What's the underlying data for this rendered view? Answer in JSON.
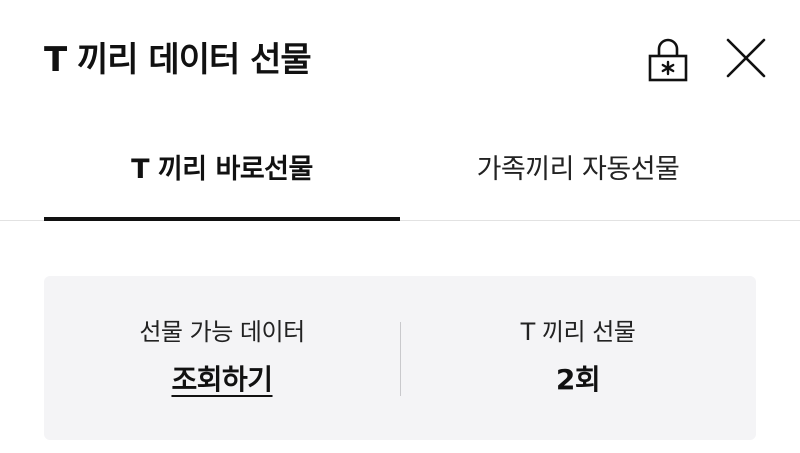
{
  "header": {
    "title": "T 끼리 데이터 선물",
    "lock_icon": "lock-asterisk-icon",
    "close_icon": "close-icon"
  },
  "tabs": [
    {
      "label": "T 끼리 바로선물",
      "active": true
    },
    {
      "label": "가족끼리 자동선물",
      "active": false
    }
  ],
  "info": {
    "data_label": "선물 가능 데이터",
    "data_link": "조회하기",
    "gift_label": "T 끼리 선물",
    "gift_count": "2회"
  },
  "colors": {
    "text": "#111111",
    "card_background": "#f4f4f6",
    "active_tab_underline": "#111111",
    "divider": "#e2e2e2"
  }
}
